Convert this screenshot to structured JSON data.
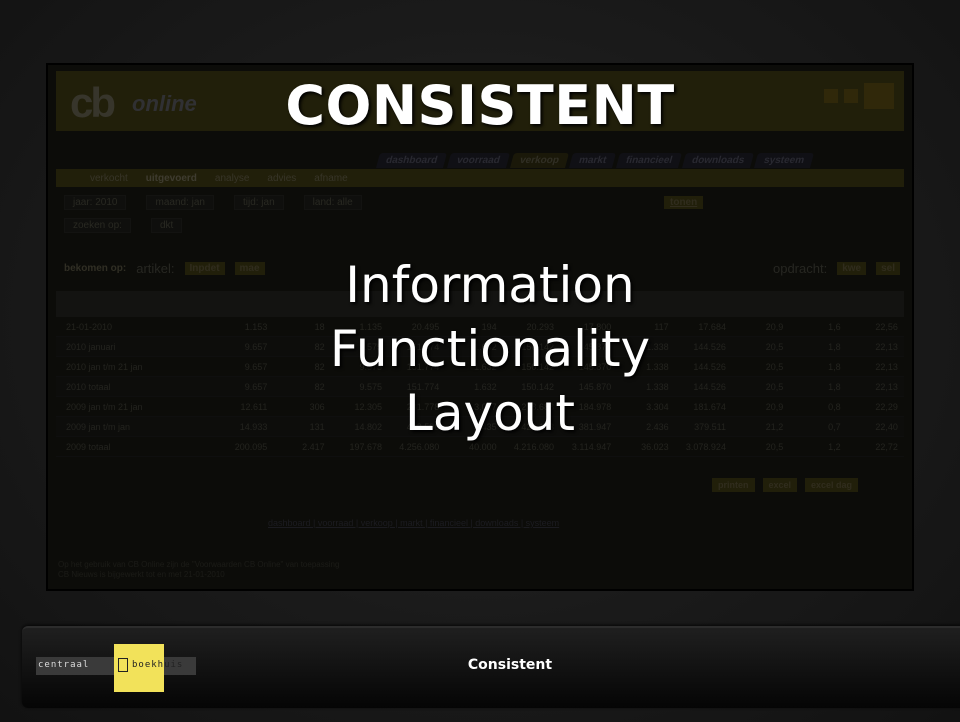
{
  "slide": {
    "title": "CONSISTENT",
    "items": [
      "Information",
      "Functionality",
      "Layout"
    ],
    "footer_title": "Consistent"
  },
  "brand": {
    "logo_left": "centraal",
    "logo_right": "boekhuis"
  },
  "screenshot": {
    "logo": "cb",
    "logo_sub": "online",
    "tabs": [
      "dashboard",
      "voorraad",
      "verkoop",
      "markt",
      "financieel",
      "downloads",
      "systeem"
    ],
    "active_tab": "verkoop",
    "subtabs": [
      "verkocht",
      "uitgevoerd",
      "analyse",
      "advies",
      "afname"
    ],
    "filters": {
      "jaar_label": "jaar: 2010",
      "maand_label": "maand: jan",
      "tijd_label": "tijd: jan",
      "land_label": "land: alle",
      "zoeken_label": "zoeken op:",
      "dkt_label": "dkt"
    },
    "tonen_label": "tonen",
    "groep_label": "bekomen op:",
    "artikel_label": "artikel:",
    "opdracht_label": "opdracht:",
    "groep_buttons": [
      "Inpdet",
      "mae"
    ],
    "opdracht_buttons": [
      "kwe",
      "sel"
    ],
    "rows": [
      {
        "label": "21-01-2010",
        "values": [
          "1.153",
          "18",
          "1.135",
          "20.495",
          "194",
          "20.293",
          "17.800",
          "117",
          "17.684",
          "20,9",
          "1,6",
          "22,56"
        ]
      },
      {
        "label": "2010 januari",
        "values": [
          "9.657",
          "82",
          "9.575",
          "151.774",
          "1.632",
          "150.142",
          "145.870",
          "1.338",
          "144.526",
          "20,5",
          "1,8",
          "22,13"
        ]
      },
      {
        "label": "2010 jan t/m 21 jan",
        "values": [
          "9.657",
          "82",
          "9.575",
          "151.774",
          "1.632",
          "150.142",
          "145.870",
          "1.338",
          "144.526",
          "20,5",
          "1,8",
          "22,13"
        ]
      },
      {
        "label": "2010 totaal",
        "values": [
          "9.657",
          "82",
          "9.575",
          "151.774",
          "1.632",
          "150.142",
          "145.870",
          "1.338",
          "144.526",
          "20,5",
          "1,8",
          "22,13"
        ]
      },
      {
        "label": "2009 jan t/m 21 jan",
        "values": [
          "12.611",
          "306",
          "12.305",
          "281.778",
          "3.087",
          "278.688",
          "184.978",
          "3.304",
          "181.674",
          "20,9",
          "0,8",
          "22,29"
        ]
      },
      {
        "label": "2009 jan t/m jan",
        "values": [
          "14.933",
          "131",
          "14.802",
          "423.598",
          "3.435",
          "420.163",
          "381.947",
          "2.436",
          "379.511",
          "21,2",
          "0,7",
          "22,40"
        ]
      },
      {
        "label": "2009 totaal",
        "values": [
          "200.095",
          "2.417",
          "197.678",
          "4.256.080",
          "40.000",
          "4.216.080",
          "3.114.947",
          "36.023",
          "3.078.924",
          "20,5",
          "1,2",
          "22,72"
        ]
      }
    ],
    "action_buttons": [
      "printen",
      "excel",
      "excel dag"
    ],
    "footer_links": "dashboard | voorraad | verkoop | markt | financieel | downloads | systeem",
    "footnote_line1": "Op het gebruik van CB Online zijn de \"Voorwaarden CB Online\" van toepassing",
    "footnote_line2": "CB Nieuws is bijgewerkt tot en met 21-01-2010"
  }
}
